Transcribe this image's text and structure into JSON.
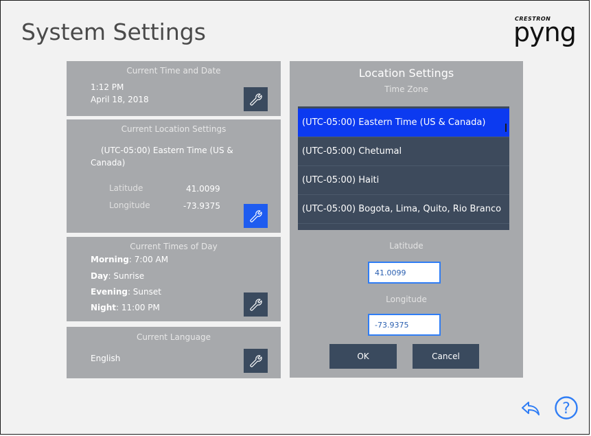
{
  "header": {
    "title": "System Settings",
    "logo_brand": "CRESTRON",
    "logo_word": "pyng"
  },
  "time_panel": {
    "title": "Current Time and Date",
    "time": "1:12 PM",
    "date": "April 18, 2018"
  },
  "location_panel": {
    "title": "Current Location Settings",
    "timezone_line1": "(UTC-05:00) Eastern Time (US &",
    "timezone_line2": "Canada)",
    "latitude_label": "Latitude",
    "latitude_value": "41.0099",
    "longitude_label": "Longitude",
    "longitude_value": "-73.9375"
  },
  "times_of_day_panel": {
    "title": "Current Times of Day",
    "morning_label": "Morning",
    "morning_value": ": 7:00 AM",
    "day_label": "Day",
    "day_value": ": Sunrise",
    "evening_label": "Evening",
    "evening_value": ": Sunset",
    "night_label": "Night",
    "night_value": ": 11:00 PM"
  },
  "language_panel": {
    "title": "Current Language",
    "value": "English"
  },
  "location_settings": {
    "title": "Location Settings",
    "timezone_label": "Time Zone",
    "timezones": [
      "(UTC-05:00) Eastern Time (US & Canada)",
      "(UTC-05:00) Chetumal",
      "(UTC-05:00) Haiti",
      "(UTC-05:00) Bogota, Lima, Quito, Rio Branco"
    ],
    "latitude_label": "Latitude",
    "latitude_value": "41.0099",
    "longitude_label": "Longitude",
    "longitude_value": "-73.9375",
    "ok_label": "OK",
    "cancel_label": "Cancel"
  },
  "colors": {
    "accent": "#1e5cf0",
    "selected_row": "#0c3af0",
    "button": "#3a4a5e",
    "panel": "#a7a9ac",
    "help": "#2f7df5"
  },
  "icons": [
    "wrench-icon",
    "back-arrow-icon",
    "help-icon"
  ]
}
